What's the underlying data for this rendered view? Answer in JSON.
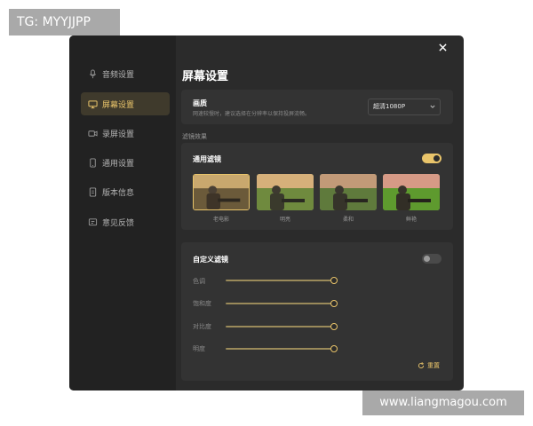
{
  "watermarks": {
    "top_left": "TG: MYYJJPP",
    "bottom_right": "www.liangmagou.com"
  },
  "sidebar": {
    "items": [
      {
        "label": "音频设置",
        "icon": "microphone-icon",
        "active": false
      },
      {
        "label": "屏幕设置",
        "icon": "monitor-icon",
        "active": true
      },
      {
        "label": "录屏设置",
        "icon": "video-camera-icon",
        "active": false
      },
      {
        "label": "通用设置",
        "icon": "phone-icon",
        "active": false
      },
      {
        "label": "版本信息",
        "icon": "document-icon",
        "active": false
      },
      {
        "label": "意见反馈",
        "icon": "feedback-icon",
        "active": false
      }
    ]
  },
  "main": {
    "title": "屏幕设置",
    "quality": {
      "label": "画质",
      "hint": "网速较慢时，建议选择在分辨率以保持投屏流畅。",
      "selected": "超清1080P"
    },
    "filter_section_label": "滤镜效果",
    "general_filter": {
      "label": "通用滤镜",
      "enabled": true,
      "presets": [
        {
          "caption": "老电影",
          "selected": true
        },
        {
          "caption": "明亮",
          "selected": false
        },
        {
          "caption": "柔和",
          "selected": false
        },
        {
          "caption": "鲜艳",
          "selected": false
        }
      ]
    },
    "custom_filter": {
      "label": "自定义滤镜",
      "enabled": false,
      "sliders": [
        {
          "label": "色调",
          "level": 1.0
        },
        {
          "label": "饱和度",
          "level": 1.0
        },
        {
          "label": "对比度",
          "level": 1.0
        },
        {
          "label": "明度",
          "level": 1.0
        }
      ],
      "reset_label": "重置"
    }
  },
  "colors": {
    "accent": "#e9c46a",
    "panel": "#2b2b2b",
    "sidebar": "#222222",
    "card": "#333333"
  }
}
